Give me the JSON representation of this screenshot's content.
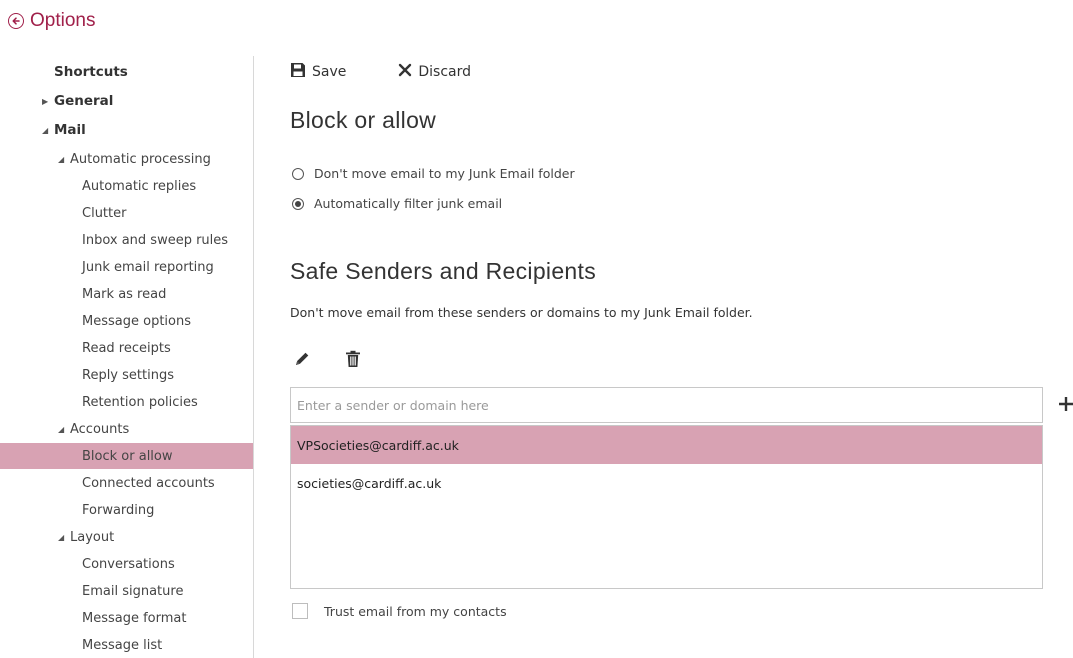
{
  "header": {
    "title": "Options",
    "back_icon": "circle-arrow-left-icon"
  },
  "sidebar": {
    "items": [
      {
        "label": "Shortcuts",
        "level": 0,
        "bold": true,
        "expander": ""
      },
      {
        "label": "General",
        "level": 0,
        "bold": true,
        "expander": "collapsed"
      },
      {
        "label": "Mail",
        "level": 0,
        "bold": true,
        "expander": "expanded"
      },
      {
        "label": "Automatic processing",
        "level": 1,
        "bold": false,
        "expander": "expanded"
      },
      {
        "label": "Automatic replies",
        "level": 2,
        "bold": false,
        "expander": ""
      },
      {
        "label": "Clutter",
        "level": 2,
        "bold": false,
        "expander": ""
      },
      {
        "label": "Inbox and sweep rules",
        "level": 2,
        "bold": false,
        "expander": ""
      },
      {
        "label": "Junk email reporting",
        "level": 2,
        "bold": false,
        "expander": ""
      },
      {
        "label": "Mark as read",
        "level": 2,
        "bold": false,
        "expander": ""
      },
      {
        "label": "Message options",
        "level": 2,
        "bold": false,
        "expander": ""
      },
      {
        "label": "Read receipts",
        "level": 2,
        "bold": false,
        "expander": ""
      },
      {
        "label": "Reply settings",
        "level": 2,
        "bold": false,
        "expander": ""
      },
      {
        "label": "Retention policies",
        "level": 2,
        "bold": false,
        "expander": ""
      },
      {
        "label": "Accounts",
        "level": 1,
        "bold": false,
        "expander": "expanded"
      },
      {
        "label": "Block or allow",
        "level": 2,
        "bold": false,
        "expander": "",
        "selected": true
      },
      {
        "label": "Connected accounts",
        "level": 2,
        "bold": false,
        "expander": ""
      },
      {
        "label": "Forwarding",
        "level": 2,
        "bold": false,
        "expander": ""
      },
      {
        "label": "Layout",
        "level": 1,
        "bold": false,
        "expander": "expanded"
      },
      {
        "label": "Conversations",
        "level": 2,
        "bold": false,
        "expander": ""
      },
      {
        "label": "Email signature",
        "level": 2,
        "bold": false,
        "expander": ""
      },
      {
        "label": "Message format",
        "level": 2,
        "bold": false,
        "expander": ""
      },
      {
        "label": "Message list",
        "level": 2,
        "bold": false,
        "expander": ""
      }
    ]
  },
  "toolbar": {
    "save_label": "Save",
    "save_icon": "floppy-disk-icon",
    "discard_label": "Discard",
    "discard_icon": "x-icon"
  },
  "main": {
    "title": "Block or allow",
    "radio_options": [
      {
        "label": "Don't move email to my Junk Email folder",
        "checked": false
      },
      {
        "label": "Automatically filter junk email",
        "checked": true
      }
    ],
    "safe_senders": {
      "title": "Safe Senders and Recipients",
      "description": "Don't move email from these senders or domains to my Junk Email folder.",
      "edit_icon": "pencil-icon",
      "delete_icon": "trash-icon",
      "input_placeholder": "Enter a sender or domain here",
      "input_value": "",
      "add_icon": "plus-icon",
      "entries": [
        "VPSocieties@cardiff.ac.uk",
        "societies@cardiff.ac.uk"
      ],
      "selected_index": 0
    },
    "trust_contacts": {
      "label": "Trust email from my contacts",
      "checked": false
    }
  },
  "colors": {
    "accent": "#a0204a",
    "selection": "#d8a2b3"
  }
}
